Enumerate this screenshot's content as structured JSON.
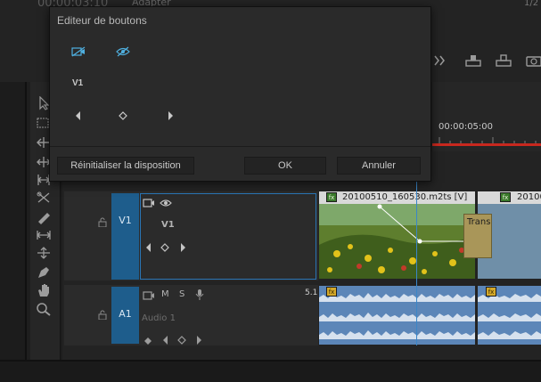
{
  "program_monitor": {
    "timecode": "00:00:03:10",
    "fit_select": "Adapter",
    "page_indicator": "1/2"
  },
  "timeline": {
    "ruler_time": "00:00:05:00",
    "tracks": {
      "v1": {
        "target_label": "V1",
        "editor_label": "V1"
      },
      "a1": {
        "target_label": "A1",
        "track_name": "Audio 1",
        "mute_label": "M",
        "solo_label": "S",
        "channel_label": "5.1"
      }
    },
    "clips": {
      "video1_name": "20100510_160530.m2ts [V]",
      "video2_name": "20100",
      "transition_label": "Trans",
      "fx_label": "fx"
    }
  },
  "dialog": {
    "title": "Editeur de boutons",
    "v1_label": "V1",
    "reset_button": "Réinitialiser la disposition",
    "ok_button": "OK",
    "cancel_button": "Annuler"
  },
  "colors": {
    "target_blue": "#1e5d8c",
    "selection_outline": "#2a74b4",
    "playhead_red": "#c8281e",
    "icon_cyan": "#4fb0e0"
  }
}
